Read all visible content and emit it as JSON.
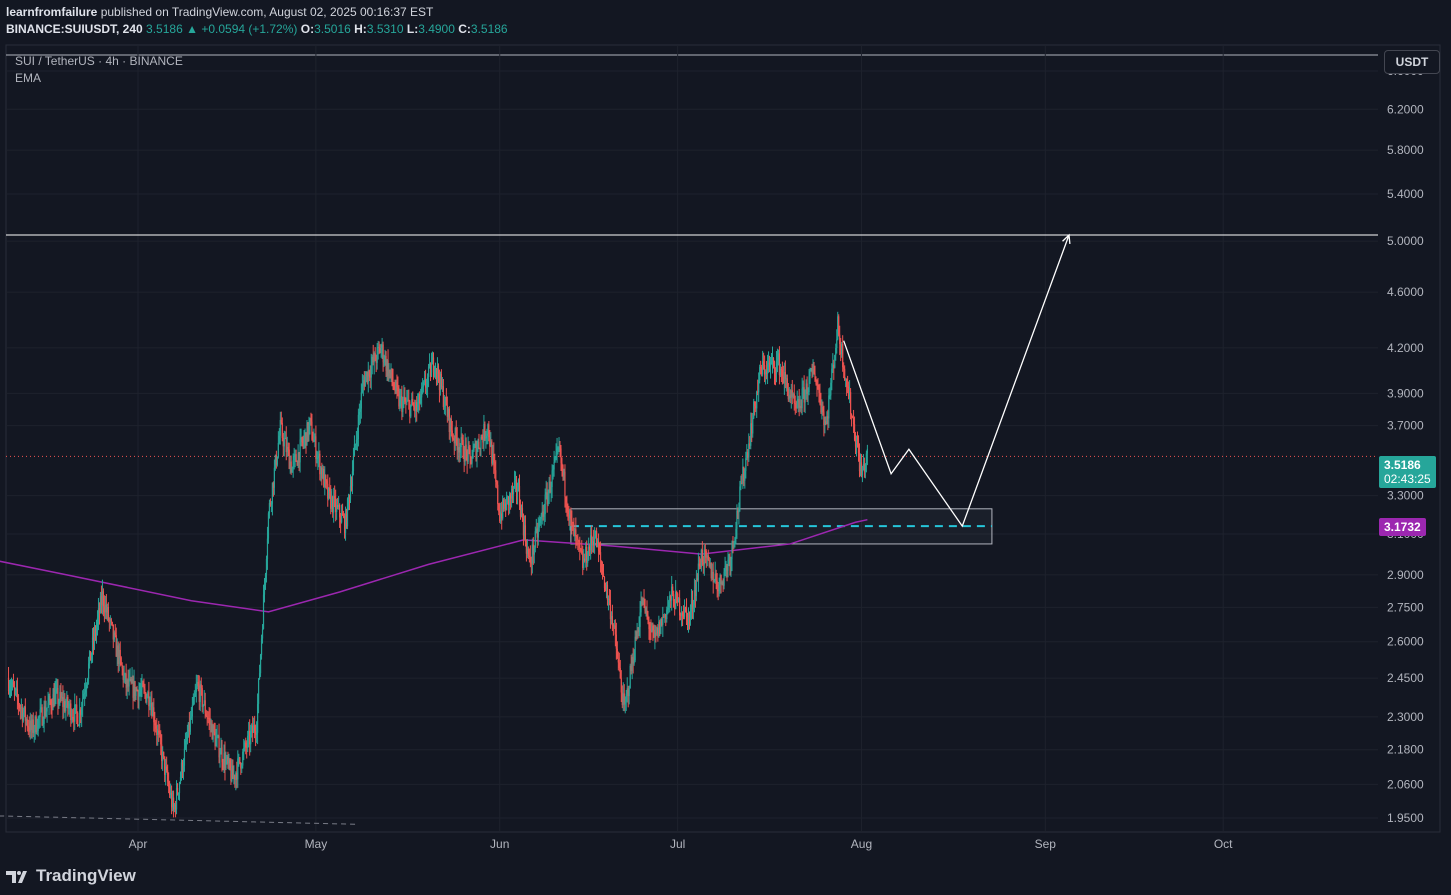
{
  "header": {
    "author": "learnfromfailure",
    "published_text": "published on TradingView.com, August 02, 2025 00:16:37 EST",
    "symbol": "BINANCE:SUIUSDT, 240",
    "last": "3.5186",
    "change": "+0.0594 (+1.72%)",
    "o_label": "O:",
    "o": "3.5016",
    "h_label": "H:",
    "h": "3.5310",
    "l_label": "L:",
    "l": "3.4900",
    "c_label": "C:",
    "c": "3.5186"
  },
  "legend": {
    "title": "SUI / TetherUS · 4h · BINANCE",
    "indicator": "EMA"
  },
  "axis": {
    "currency_button": "USDT",
    "last_price": "3.5186",
    "countdown": "02:43:25",
    "ema_value": "3.1732"
  },
  "footer": {
    "brand": "TradingView"
  },
  "colors": {
    "background": "#131722",
    "up": "#26a69a",
    "down": "#ef5350",
    "ema": "#9c27b0",
    "zone_line": "#26c6da"
  },
  "chart_data": {
    "type": "candlestick",
    "scale": "log",
    "y_ticks": [
      "6.6000",
      "6.2000",
      "5.8000",
      "5.4000",
      "5.0000",
      "4.6000",
      "4.2000",
      "3.9000",
      "3.7000",
      "3.3000",
      "3.1000",
      "2.9000",
      "2.7500",
      "2.6000",
      "2.4500",
      "2.3000",
      "2.1800",
      "2.0600",
      "1.9500"
    ],
    "x_ticks": [
      "Apr",
      "May",
      "Jun",
      "Jul",
      "Aug",
      "Sep",
      "Oct"
    ],
    "price_path": [
      [
        "2025-03-10",
        2.45
      ],
      [
        "2025-03-14",
        2.25
      ],
      [
        "2025-03-18",
        2.38
      ],
      [
        "2025-03-22",
        2.3
      ],
      [
        "2025-03-26",
        2.8
      ],
      [
        "2025-03-30",
        2.42
      ],
      [
        "2025-04-03",
        2.38
      ],
      [
        "2025-04-07",
        1.97
      ],
      [
        "2025-04-11",
        2.42
      ],
      [
        "2025-04-14",
        2.22
      ],
      [
        "2025-04-17",
        2.08
      ],
      [
        "2025-04-21",
        2.28
      ],
      [
        "2025-04-23",
        3.2
      ],
      [
        "2025-04-25",
        3.68
      ],
      [
        "2025-04-27",
        3.45
      ],
      [
        "2025-04-30",
        3.7
      ],
      [
        "2025-05-03",
        3.3
      ],
      [
        "2025-05-06",
        3.15
      ],
      [
        "2025-05-09",
        3.98
      ],
      [
        "2025-05-12",
        4.2
      ],
      [
        "2025-05-15",
        3.85
      ],
      [
        "2025-05-18",
        3.8
      ],
      [
        "2025-05-21",
        4.12
      ],
      [
        "2025-05-24",
        3.65
      ],
      [
        "2025-05-27",
        3.5
      ],
      [
        "2025-05-30",
        3.7
      ],
      [
        "2025-06-01",
        3.2
      ],
      [
        "2025-06-04",
        3.35
      ],
      [
        "2025-06-06",
        2.95
      ],
      [
        "2025-06-08",
        3.18
      ],
      [
        "2025-06-11",
        3.55
      ],
      [
        "2025-06-13",
        3.15
      ],
      [
        "2025-06-15",
        2.95
      ],
      [
        "2025-06-17",
        3.1
      ],
      [
        "2025-06-20",
        2.7
      ],
      [
        "2025-06-22",
        2.32
      ],
      [
        "2025-06-25",
        2.78
      ],
      [
        "2025-06-27",
        2.6
      ],
      [
        "2025-06-30",
        2.8
      ],
      [
        "2025-07-03",
        2.7
      ],
      [
        "2025-07-05",
        3.0
      ],
      [
        "2025-07-08",
        2.85
      ],
      [
        "2025-07-10",
        3.0
      ],
      [
        "2025-07-12",
        3.4
      ],
      [
        "2025-07-15",
        4.05
      ],
      [
        "2025-07-18",
        4.1
      ],
      [
        "2025-07-21",
        3.78
      ],
      [
        "2025-07-24",
        4.05
      ],
      [
        "2025-07-26",
        3.7
      ],
      [
        "2025-07-28",
        4.35
      ],
      [
        "2025-07-30",
        3.85
      ],
      [
        "2025-08-01",
        3.42
      ],
      [
        "2025-08-02",
        3.5186
      ]
    ],
    "ema_path": [
      [
        "2025-03-01",
        3.01
      ],
      [
        "2025-03-20",
        2.9
      ],
      [
        "2025-04-10",
        2.78
      ],
      [
        "2025-04-23",
        2.73
      ],
      [
        "2025-05-05",
        2.82
      ],
      [
        "2025-05-20",
        2.95
      ],
      [
        "2025-06-05",
        3.07
      ],
      [
        "2025-06-20",
        3.04
      ],
      [
        "2025-07-05",
        3.0
      ],
      [
        "2025-07-20",
        3.05
      ],
      [
        "2025-07-31",
        3.16
      ],
      [
        "2025-08-02",
        3.1732
      ]
    ],
    "horizontal_levels": [
      {
        "price": 5.05,
        "style": "solid"
      },
      {
        "price": 3.5186,
        "style": "dotted",
        "role": "last-price"
      },
      {
        "price": 3.14,
        "style": "dashed",
        "role": "zone-mid"
      }
    ],
    "zone": {
      "from": "2025-06-13",
      "to": "2025-08-23",
      "low": 3.05,
      "high": 3.23
    },
    "projection": [
      [
        "2025-07-29",
        4.25
      ],
      [
        "2025-08-06",
        3.42
      ],
      [
        "2025-08-09",
        3.56
      ],
      [
        "2025-08-18",
        3.14
      ],
      [
        "2025-09-05",
        5.05
      ]
    ],
    "trendline": [
      [
        "2025-03-01",
        1.96
      ],
      [
        "2025-05-08",
        1.93
      ]
    ]
  }
}
